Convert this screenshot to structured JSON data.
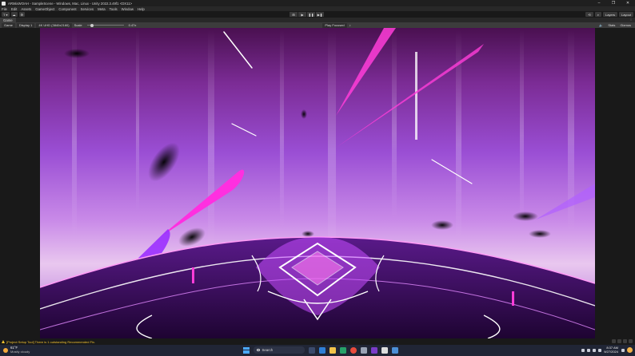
{
  "window": {
    "title": "ARMixWOAH - SampleScene - Windows, Mac, Linux - Unity 2022.3.49f1 <DX11>",
    "controls": [
      "–",
      "❐",
      "✕"
    ]
  },
  "menu": [
    "File",
    "Edit",
    "Assets",
    "GameObject",
    "Component",
    "Services",
    "Meta",
    "Tools",
    "Window",
    "Help"
  ],
  "toolbar": {
    "account_label": "T ▾",
    "play_buttons": [
      "⊞",
      "▶",
      "❚❚",
      "▶❚"
    ],
    "layers_label": "Layers",
    "layout_label": "Layout"
  },
  "tab": {
    "label": "Game",
    "menu_glyph": "⋮"
  },
  "game_toolbar": {
    "mode": "Game",
    "display": "Display 1",
    "resolution": "4K UHD (3840x2160)",
    "scale_label": "Scale",
    "scale_value": "0.47x",
    "scale_level": 0.1,
    "play_mode": "Play Focused",
    "stats_label": "Stats",
    "gizmos_label": "Gizmos"
  },
  "status": {
    "message": "[Project Setup Tool] There is 1 outstanding Recommended Fix."
  },
  "taskbar": {
    "weather_temp": "61°F",
    "weather_condition": "Mostly cloudy",
    "search_placeholder": "Search",
    "time": "8:37 AM",
    "date": "9/27/2024"
  },
  "colors": {
    "accent_magenta": "#ff3dd8",
    "accent_violet": "#9b30ff",
    "warning": "#f2c230",
    "editor_bg": "#191919"
  },
  "icons": [
    "unity-logo-icon",
    "warning-icon",
    "search-icon",
    "windows-start-icon",
    "sun-icon"
  ]
}
